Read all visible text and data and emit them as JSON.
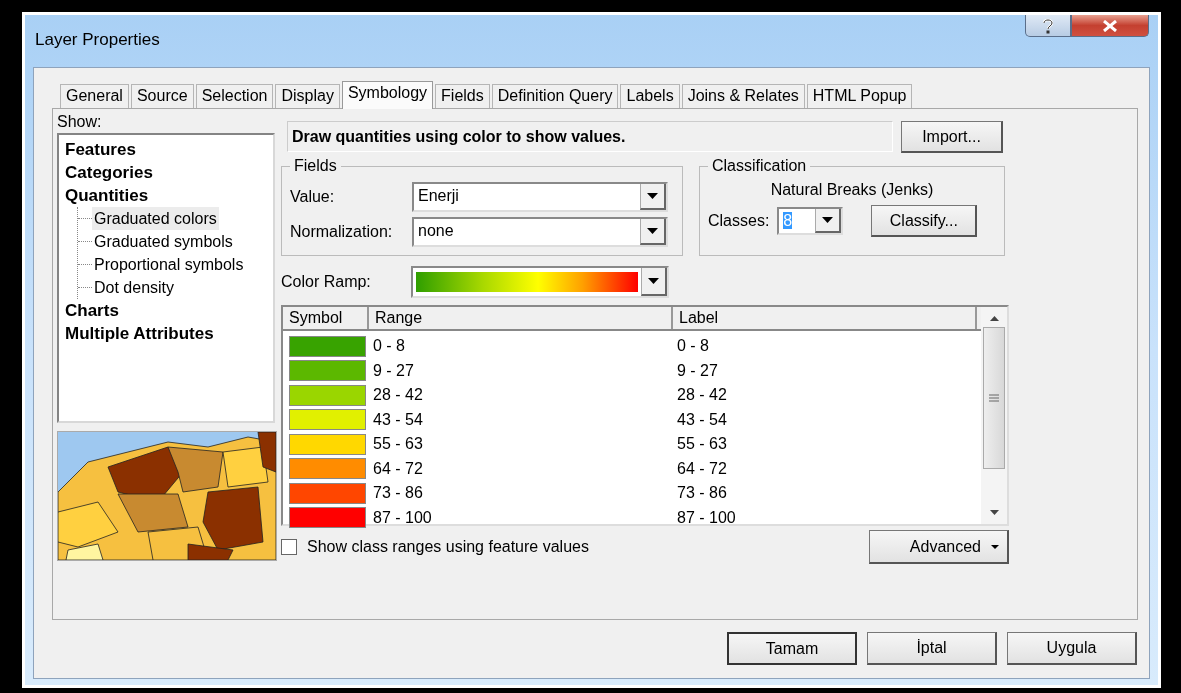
{
  "window": {
    "title": "Layer Properties"
  },
  "tabs": [
    {
      "label": "General",
      "selected": false
    },
    {
      "label": "Source",
      "selected": false
    },
    {
      "label": "Selection",
      "selected": false
    },
    {
      "label": "Display",
      "selected": false
    },
    {
      "label": "Symbology",
      "selected": true
    },
    {
      "label": "Fields",
      "selected": false
    },
    {
      "label": "Definition Query",
      "selected": false
    },
    {
      "label": "Labels",
      "selected": false
    },
    {
      "label": "Joins & Relates",
      "selected": false
    },
    {
      "label": "HTML Popup",
      "selected": false
    }
  ],
  "show": {
    "label": "Show:",
    "items": [
      {
        "label": "Features",
        "selected": false
      },
      {
        "label": "Categories",
        "selected": false
      },
      {
        "label": "Quantities",
        "selected": false,
        "children": [
          {
            "label": "Graduated colors",
            "selected": true
          },
          {
            "label": "Graduated symbols",
            "selected": false
          },
          {
            "label": "Proportional symbols",
            "selected": false
          },
          {
            "label": "Dot density",
            "selected": false
          }
        ]
      },
      {
        "label": "Charts",
        "selected": false
      },
      {
        "label": "Multiple Attributes",
        "selected": false
      }
    ]
  },
  "description": "Draw quantities using color to show values.",
  "import_button": "Import...",
  "fields": {
    "title": "Fields",
    "value_label": "Value:",
    "value": "Enerji",
    "normalization_label": "Normalization:",
    "normalization": "none"
  },
  "classification": {
    "title": "Classification",
    "method": "Natural Breaks (Jenks)",
    "classes_label": "Classes:",
    "classes": "8",
    "classify_button": "Classify..."
  },
  "color_ramp": {
    "label": "Color Ramp:"
  },
  "table": {
    "columns": [
      "Symbol",
      "Range",
      "Label"
    ],
    "rows": [
      {
        "color": "#38a300",
        "range": "0 - 8",
        "label": "0 - 8"
      },
      {
        "color": "#5cb800",
        "range": "9 - 27",
        "label": "9 - 27"
      },
      {
        "color": "#9ad600",
        "range": "28 - 42",
        "label": "28 - 42"
      },
      {
        "color": "#e1f000",
        "range": "43 - 54",
        "label": "43 - 54"
      },
      {
        "color": "#ffd800",
        "range": "55 - 63",
        "label": "55 - 63"
      },
      {
        "color": "#ff8c00",
        "range": "64 - 72",
        "label": "64 - 72"
      },
      {
        "color": "#ff4600",
        "range": "73 - 86",
        "label": "73 - 86"
      },
      {
        "color": "#ff0000",
        "range": "87 - 100",
        "label": "87 - 100"
      }
    ]
  },
  "feature_ranges_option": {
    "label": "Show class ranges using feature values",
    "checked": false
  },
  "advanced_button": "Advanced",
  "buttons": [
    "Tamam",
    "İptal",
    "Uygula"
  ]
}
